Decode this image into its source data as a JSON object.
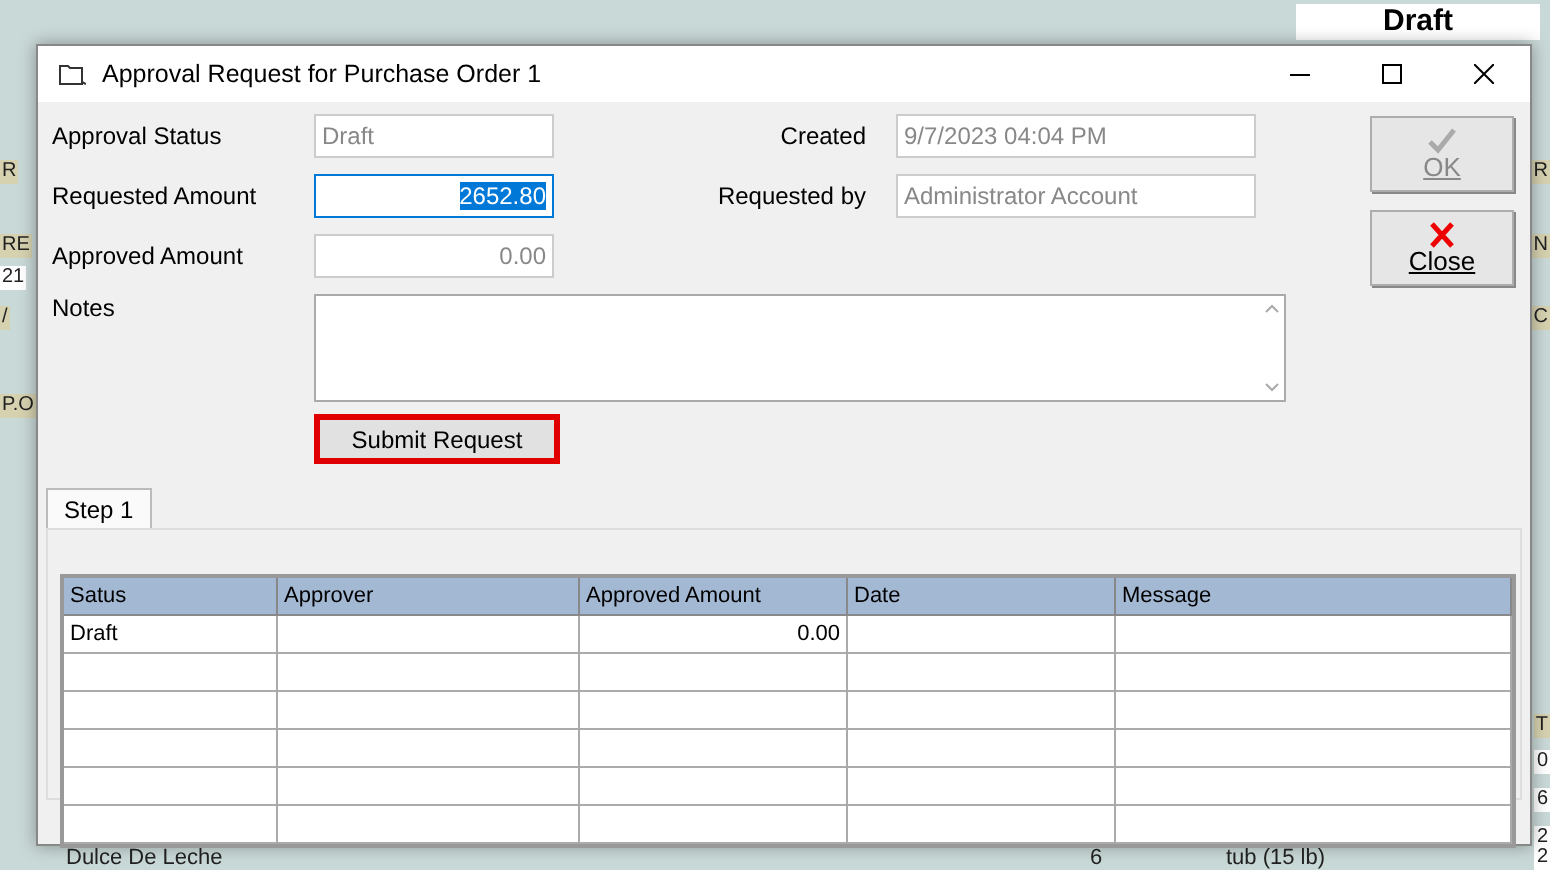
{
  "background": {
    "top_right": "Draft",
    "left_fragments": [
      "R",
      "RE",
      "21",
      "/",
      "P.O"
    ],
    "right_fragments": [
      "R",
      "N",
      "C",
      "T",
      "0",
      "6",
      "2",
      "2"
    ],
    "bottom_row": [
      "Dulce De Leche",
      "6",
      "tub (15 lb)"
    ]
  },
  "window": {
    "title": "Approval Request for Purchase Order 1"
  },
  "left_fields": [
    {
      "label": "Approval Status",
      "value": "Draft",
      "kind": "text",
      "disabled": true,
      "focused": false
    },
    {
      "label": "Requested Amount",
      "value": "2652.80",
      "kind": "amount",
      "disabled": false,
      "focused": true
    },
    {
      "label": "Approved Amount",
      "value": "0.00",
      "kind": "amount",
      "disabled": true,
      "focused": false
    }
  ],
  "right_fields": [
    {
      "label": "Created",
      "value": "9/7/2023 04:04 PM",
      "kind": "text",
      "disabled": true,
      "focused": false
    },
    {
      "label": "Requested by",
      "value": "Administrator Account",
      "kind": "text",
      "disabled": true,
      "focused": false
    }
  ],
  "notes": {
    "label": "Notes"
  },
  "submit": {
    "label": "Submit Request",
    "highlighted": true
  },
  "side_buttons": [
    {
      "label": "OK",
      "kind": "ok",
      "disabled": true
    },
    {
      "label": "Close",
      "kind": "close",
      "disabled": false
    }
  ],
  "tabs": [
    {
      "label": "Step 1",
      "selected": true
    }
  ],
  "table": {
    "columns": [
      "Satus",
      "Approver",
      "Approved Amount",
      "Date",
      "Message"
    ],
    "rows": [
      {
        "status": "Draft",
        "approved_amount": "0.00"
      }
    ]
  }
}
